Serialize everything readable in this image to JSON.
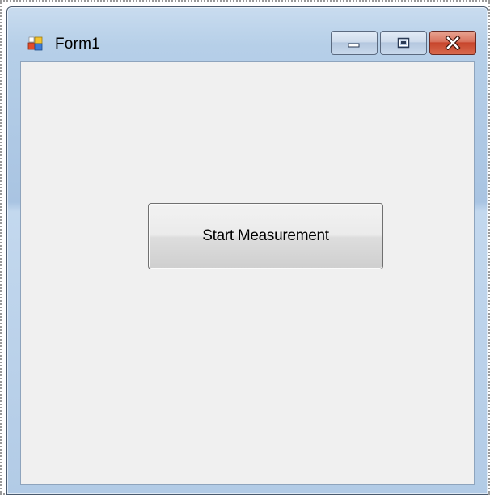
{
  "window": {
    "title": "Form1"
  },
  "caption_buttons": {
    "minimize": "minimize-icon",
    "maximize": "maximize-icon",
    "close": "close-icon"
  },
  "form": {
    "start_button_label": "Start Measurement"
  },
  "colors": {
    "client_background": "#f0f0f0",
    "title_bar": "#b6cfe8",
    "close_button": "#c7452c"
  }
}
